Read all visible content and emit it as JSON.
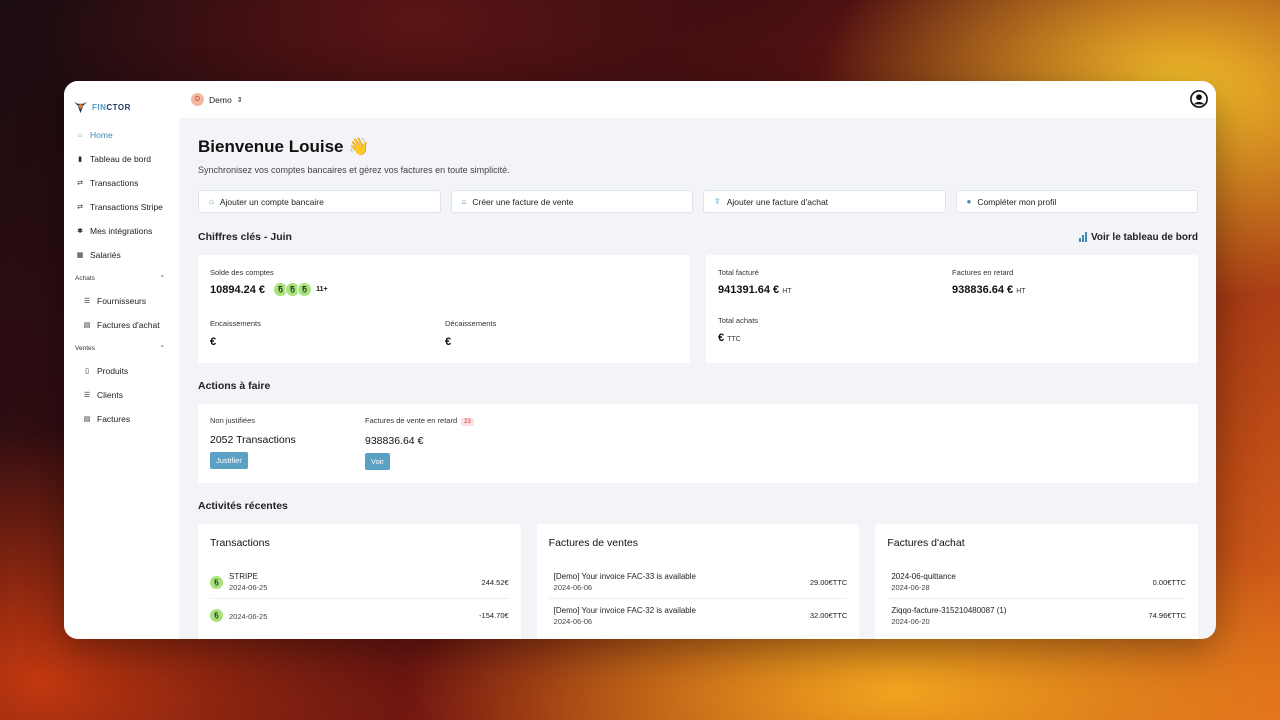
{
  "app": {
    "logo_prefix": "FIN",
    "logo_suffix": "CTOR"
  },
  "sidebar": {
    "items": [
      {
        "label": "Home",
        "icon": "home-icon"
      },
      {
        "label": "Tableau de bord",
        "icon": "chart-icon"
      },
      {
        "label": "Transactions",
        "icon": "transactions-icon"
      },
      {
        "label": "Transactions Stripe",
        "icon": "transactions-icon"
      },
      {
        "label": "Mes intégrations",
        "icon": "puzzle-icon"
      },
      {
        "label": "Salariés",
        "icon": "people-icon"
      }
    ],
    "section_achats": "Achats",
    "achats_items": [
      {
        "label": "Fournisseurs"
      },
      {
        "label": "Factures d'achat"
      }
    ],
    "section_ventes": "Ventes",
    "ventes_items": [
      {
        "label": "Produits"
      },
      {
        "label": "Clients"
      },
      {
        "label": "Factures"
      }
    ]
  },
  "topbar": {
    "org_initial": "D",
    "org_name": "Demo"
  },
  "main": {
    "welcome": "Bienvenue Louise 👋",
    "subtitle": "Synchronisez vos comptes bancaires et gérez vos factures en toute simplicité.",
    "quick_actions": [
      {
        "label": "Ajouter un compte bancaire",
        "icon": "bank-icon"
      },
      {
        "label": "Créer une facture de vente",
        "icon": "bank-icon"
      },
      {
        "label": "Ajouter une facture d'achat",
        "icon": "upload-icon"
      },
      {
        "label": "Compléter mon profil",
        "icon": "user-icon"
      }
    ],
    "kpi_title": "Chiffres clés - Juin",
    "dashboard_link": "Voir le tableau de bord",
    "solde_label": "Solde des comptes",
    "solde_value": "10894.24 €",
    "bank_more": "11+",
    "encaissements_label": "Encaissements",
    "encaissements_value": "€",
    "decaissements_label": "Décaissements",
    "decaissements_value": "€",
    "total_facture_label": "Total facturé",
    "total_facture_value": "941391.64 €",
    "total_facture_unit": "HT",
    "retard_label": "Factures en retard",
    "retard_value": "938836.64 €",
    "retard_unit": "HT",
    "achats_label": "Total achats",
    "achats_value": "€",
    "achats_unit": "TTC",
    "actions_title": "Actions à faire",
    "non_justifiees_label": "Non justifiées",
    "non_justifiees_value": "2052 Transactions",
    "justifier_btn": "Justifier",
    "ventes_retard_label": "Factures de vente en retard",
    "ventes_retard_count": "23",
    "ventes_retard_value": "938836.64 €",
    "voir_btn": "Voir",
    "recent_title": "Activités récentes",
    "recent_transactions_title": "Transactions",
    "recent_ventes_title": "Factures de ventes",
    "recent_achats_title": "Factures d'achat",
    "transactions": [
      {
        "name": "STRIPE",
        "date": "2024-06-25",
        "amount": "244.52€"
      },
      {
        "name": "",
        "date": "2024-06-25",
        "amount": "-154.70€"
      }
    ],
    "ventes": [
      {
        "name": "[Demo] Your invoice FAC-33 is available",
        "date": "2024-06-06",
        "amount": "29.00€TTC"
      },
      {
        "name": "[Demo] Your invoice FAC-32 is available",
        "date": "2024-06-06",
        "amount": "32.00€TTC"
      }
    ],
    "achats": [
      {
        "name": "2024-06-quittance",
        "date": "2024-06-28",
        "amount": "0.00€TTC"
      },
      {
        "name": "Ziqqo-facture-315210480087 (1)",
        "date": "2024-06-20",
        "amount": "74.96€TTC"
      }
    ]
  }
}
